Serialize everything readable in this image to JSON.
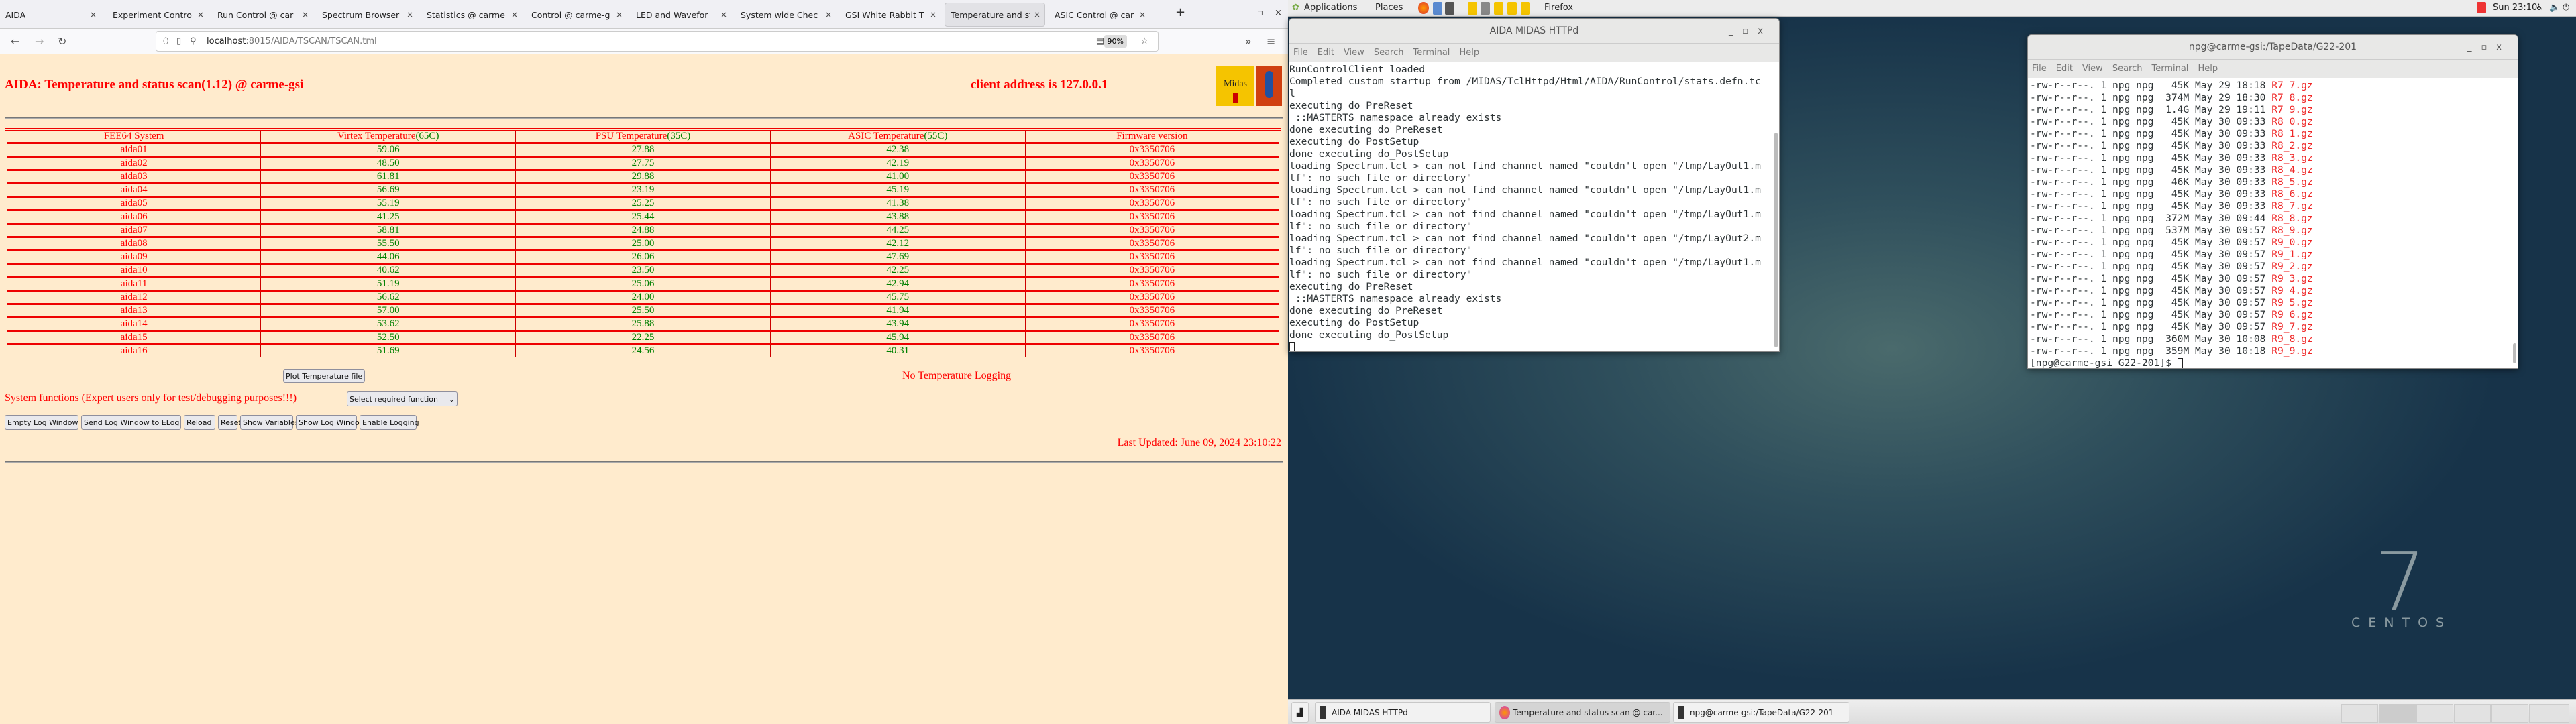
{
  "browser": {
    "tabs": [
      "AIDA",
      "Experiment Contro",
      "Run Control @ car",
      "Spectrum Browser",
      "Statistics @ carme",
      "Control @ carme-g",
      "LED and Wavefor",
      "System wide Chec",
      "GSI White Rabbit T",
      "Temperature and st",
      "ASIC Control @ car"
    ],
    "active_tab": 9,
    "new_tab": "+",
    "url_host": "localhost",
    "url_path": ":8015/AIDA/TSCAN/TSCAN.tml",
    "zoom": "90%"
  },
  "page": {
    "title": "AIDA: Temperature and status scan(1.12) @ carme-gsi",
    "client_address": "client address is 127.0.0.1",
    "logo_text": "Midas",
    "headers": [
      {
        "label": "FEE64 System",
        "limit": ""
      },
      {
        "label": "Virtex Temperature",
        "limit": "(65C)"
      },
      {
        "label": "PSU Temperature",
        "limit": "(35C)"
      },
      {
        "label": "ASIC Temperature",
        "limit": "(55C)"
      },
      {
        "label": "Firmware version",
        "limit": ""
      }
    ],
    "rows": [
      [
        "aida01",
        "59.06",
        "27.88",
        "42.38",
        "0x3350706"
      ],
      [
        "aida02",
        "48.50",
        "27.75",
        "42.19",
        "0x3350706"
      ],
      [
        "aida03",
        "61.81",
        "29.88",
        "41.00",
        "0x3350706"
      ],
      [
        "aida04",
        "56.69",
        "23.19",
        "45.19",
        "0x3350706"
      ],
      [
        "aida05",
        "55.19",
        "25.25",
        "41.38",
        "0x3350706"
      ],
      [
        "aida06",
        "41.25",
        "25.44",
        "43.88",
        "0x3350706"
      ],
      [
        "aida07",
        "58.81",
        "24.88",
        "44.25",
        "0x3350706"
      ],
      [
        "aida08",
        "55.50",
        "25.00",
        "42.12",
        "0x3350706"
      ],
      [
        "aida09",
        "44.06",
        "26.06",
        "47.69",
        "0x3350706"
      ],
      [
        "aida10",
        "40.62",
        "23.50",
        "42.25",
        "0x3350706"
      ],
      [
        "aida11",
        "51.19",
        "25.06",
        "42.94",
        "0x3350706"
      ],
      [
        "aida12",
        "56.62",
        "24.00",
        "45.75",
        "0x3350706"
      ],
      [
        "aida13",
        "57.00",
        "25.50",
        "41.94",
        "0x3350706"
      ],
      [
        "aida14",
        "53.62",
        "25.88",
        "43.94",
        "0x3350706"
      ],
      [
        "aida15",
        "52.50",
        "22.25",
        "45.94",
        "0x3350706"
      ],
      [
        "aida16",
        "51.69",
        "24.56",
        "40.31",
        "0x3350706"
      ]
    ],
    "plot_button": "Plot Temperature file",
    "no_logging": "No Temperature Logging",
    "system_functions": "System functions (Expert users only for test/debugging purposes!!!)",
    "select_value": "Select required function",
    "buttons": [
      "Empty Log Window",
      "Send Log Window to ELog",
      "Reload",
      "Reset",
      "Show Variables",
      "Show Log Window",
      "Enable Logging"
    ],
    "last_updated": "Last Updated: June 09, 2024 23:10:22"
  },
  "desktop": {
    "applications": "Applications",
    "places": "Places",
    "active_app": "Firefox",
    "clock": "Sun 23:10",
    "brand_number": "7",
    "brand_name": "CENTOS"
  },
  "terminal1": {
    "title": "AIDA MIDAS HTTPd",
    "menu": [
      "File",
      "Edit",
      "View",
      "Search",
      "Terminal",
      "Help"
    ],
    "lines": [
      "RunControlClient loaded",
      "Completed custom startup from /MIDAS/TclHttpd/Html/AIDA/RunControl/stats.defn.tc",
      "l",
      "executing do_PreReset",
      " ::MASTERTS namespace already exists",
      "done executing do_PreReset",
      "executing do_PostSetup",
      "done executing do_PostSetup",
      "loading Spectrum.tcl > can not find channel named \"couldn't open \"/tmp/LayOut1.m",
      "lf\": no such file or directory\"",
      "loading Spectrum.tcl > can not find channel named \"couldn't open \"/tmp/LayOut1.m",
      "lf\": no such file or directory\"",
      "loading Spectrum.tcl > can not find channel named \"couldn't open \"/tmp/LayOut1.m",
      "lf\": no such file or directory\"",
      "loading Spectrum.tcl > can not find channel named \"couldn't open \"/tmp/LayOut2.m",
      "lf\": no such file or directory\"",
      "loading Spectrum.tcl > can not find channel named \"couldn't open \"/tmp/LayOut1.m",
      "lf\": no such file or directory\"",
      "executing do_PreReset",
      " ::MASTERTS namespace already exists",
      "done executing do_PreReset",
      "executing do_PostSetup",
      "done executing do_PostSetup"
    ]
  },
  "terminal2": {
    "title": "npg@carme-gsi:/TapeData/G22-201",
    "menu": [
      "File",
      "Edit",
      "View",
      "Search",
      "Terminal",
      "Help"
    ],
    "lines": [
      {
        "meta": "-rw-r--r--. 1 npg npg   45K May 29 18:18 ",
        "name": "R7_7.gz"
      },
      {
        "meta": "-rw-r--r--. 1 npg npg  374M May 29 18:30 ",
        "name": "R7_8.gz"
      },
      {
        "meta": "-rw-r--r--. 1 npg npg  1.4G May 29 19:11 ",
        "name": "R7_9.gz"
      },
      {
        "meta": "-rw-r--r--. 1 npg npg   45K May 30 09:33 ",
        "name": "R8_0.gz"
      },
      {
        "meta": "-rw-r--r--. 1 npg npg   45K May 30 09:33 ",
        "name": "R8_1.gz"
      },
      {
        "meta": "-rw-r--r--. 1 npg npg   45K May 30 09:33 ",
        "name": "R8_2.gz"
      },
      {
        "meta": "-rw-r--r--. 1 npg npg   45K May 30 09:33 ",
        "name": "R8_3.gz"
      },
      {
        "meta": "-rw-r--r--. 1 npg npg   45K May 30 09:33 ",
        "name": "R8_4.gz"
      },
      {
        "meta": "-rw-r--r--. 1 npg npg   46K May 30 09:33 ",
        "name": "R8_5.gz"
      },
      {
        "meta": "-rw-r--r--. 1 npg npg   45K May 30 09:33 ",
        "name": "R8_6.gz"
      },
      {
        "meta": "-rw-r--r--. 1 npg npg   45K May 30 09:33 ",
        "name": "R8_7.gz"
      },
      {
        "meta": "-rw-r--r--. 1 npg npg  372M May 30 09:44 ",
        "name": "R8_8.gz"
      },
      {
        "meta": "-rw-r--r--. 1 npg npg  537M May 30 09:57 ",
        "name": "R8_9.gz"
      },
      {
        "meta": "-rw-r--r--. 1 npg npg   45K May 30 09:57 ",
        "name": "R9_0.gz"
      },
      {
        "meta": "-rw-r--r--. 1 npg npg   45K May 30 09:57 ",
        "name": "R9_1.gz"
      },
      {
        "meta": "-rw-r--r--. 1 npg npg   45K May 30 09:57 ",
        "name": "R9_2.gz"
      },
      {
        "meta": "-rw-r--r--. 1 npg npg   45K May 30 09:57 ",
        "name": "R9_3.gz"
      },
      {
        "meta": "-rw-r--r--. 1 npg npg   45K May 30 09:57 ",
        "name": "R9_4.gz"
      },
      {
        "meta": "-rw-r--r--. 1 npg npg   45K May 30 09:57 ",
        "name": "R9_5.gz"
      },
      {
        "meta": "-rw-r--r--. 1 npg npg   45K May 30 09:57 ",
        "name": "R9_6.gz"
      },
      {
        "meta": "-rw-r--r--. 1 npg npg   45K May 30 09:57 ",
        "name": "R9_7.gz"
      },
      {
        "meta": "-rw-r--r--. 1 npg npg  360M May 30 10:08 ",
        "name": "R9_8.gz"
      },
      {
        "meta": "-rw-r--r--. 1 npg npg  359M May 30 10:18 ",
        "name": "R9_9.gz"
      }
    ],
    "prompt": "[npg@carme-gsi G22-201]$ "
  },
  "taskbar": {
    "items": [
      "AIDA MIDAS HTTPd",
      "Temperature and status scan @ car...",
      "npg@carme-gsi:/TapeData/G22-201"
    ]
  },
  "colors": {
    "page_bg": "#ffebcd",
    "alert": "#ff0000",
    "ok": "#008000",
    "file_name": "#ef2929"
  }
}
